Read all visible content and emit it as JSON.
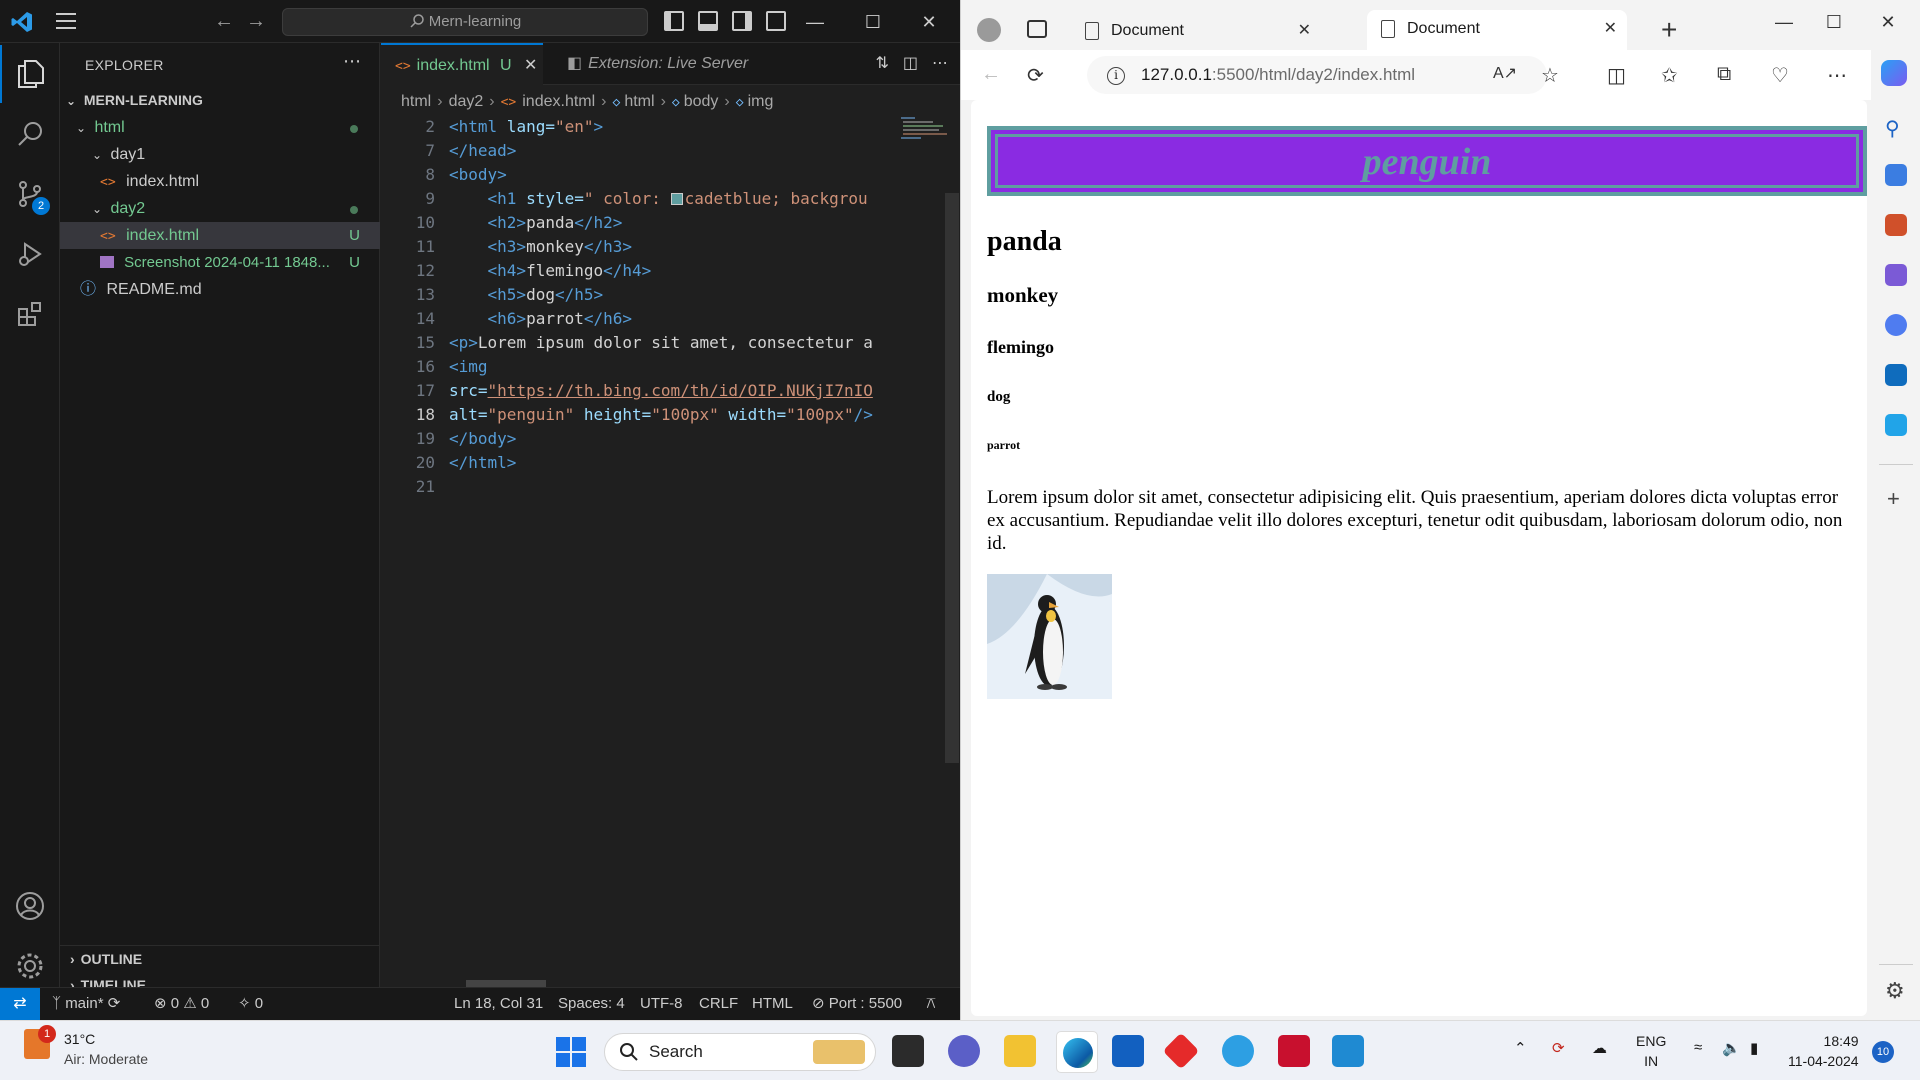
{
  "vscode": {
    "search_text": "Mern-learning",
    "explorer_title": "EXPLORER",
    "tree": {
      "root": "MERN-LEARNING",
      "html_folder": "html",
      "day1": "day1",
      "day1_file": "index.html",
      "day2": "day2",
      "day2_file": "index.html",
      "day2_file_status": "U",
      "screenshot_file": "Screenshot 2024-04-11 1848...",
      "screenshot_status": "U",
      "readme": "README.md"
    },
    "outline_label": "OUTLINE",
    "timeline_label": "TIMELINE",
    "tabs": [
      {
        "label": "index.html",
        "status": "U"
      },
      {
        "label": "Extension: Live Server"
      }
    ],
    "breadcrumb": [
      "html",
      "day2",
      "index.html",
      "html",
      "body",
      "img"
    ],
    "code_lines": [
      {
        "n": "2"
      },
      {
        "n": "7"
      },
      {
        "n": "8"
      },
      {
        "n": "9"
      },
      {
        "n": "10"
      },
      {
        "n": "11"
      },
      {
        "n": "12"
      },
      {
        "n": "13"
      },
      {
        "n": "14"
      },
      {
        "n": "15"
      },
      {
        "n": "16"
      },
      {
        "n": "17"
      },
      {
        "n": "18"
      },
      {
        "n": "19"
      },
      {
        "n": "20"
      },
      {
        "n": "21"
      }
    ],
    "code_text": {
      "l2_tag": "<html",
      "l2_attr": " lang=",
      "l2_val": "\"en\"",
      "l2_end": ">",
      "l7": "</head>",
      "l8": "<body>",
      "l9_tag": "<h1",
      "l9_attr": " style=",
      "l9_val1": "\" color: ",
      "l9_val2": "cadetblue; backgrou",
      "l10": [
        "<h2>",
        "panda",
        "</h2>"
      ],
      "l11": [
        "<h3>",
        "monkey",
        "</h3>"
      ],
      "l12": [
        "<h4>",
        "flemingo",
        "</h4>"
      ],
      "l13": [
        "<h5>",
        "dog",
        "</h5>"
      ],
      "l14": [
        "<h6>",
        "parrot",
        "</h6>"
      ],
      "l15_tag": "<p>",
      "l15_txt": "Lorem ipsum dolor sit amet, consectetur a",
      "l16": "<img",
      "l17_attr": "src=",
      "l17_val": "\"https://th.bing.com/th/id/OIP.NUKjI7nIO",
      "l18_attr1": "alt=",
      "l18_val1": "\"penguin\"",
      "l18_attr2": " height=",
      "l18_val2": "\"100px\"",
      "l18_attr3": " width=",
      "l18_val3": "\"100px\"",
      "l18_end": "/>",
      "l19": "</body>",
      "l20": "</html>"
    },
    "status": {
      "branch": "main*",
      "errors": "0",
      "warnings": "0",
      "ports": "0",
      "position": "Ln 18, Col 31",
      "spaces": "Spaces: 4",
      "encoding": "UTF-8",
      "eol": "CRLF",
      "language": "HTML",
      "port": "Port : 5500"
    },
    "badge_count": "2"
  },
  "edge": {
    "tab1": "Document",
    "tab2": "Document",
    "url_host": "127.0.0.1",
    "url_path": ":5500/html/day2/index.html",
    "page": {
      "h1": "penguin",
      "h2": "panda",
      "h3": "monkey",
      "h4": "flemingo",
      "h5": "dog",
      "h6": "parrot",
      "paragraph": "Lorem ipsum dolor sit amet, consectetur adipisicing elit. Quis praesentium, aperiam dolores dicta voluptas error ex accusantium. Repudiandae velit illo dolores excepturi, tenetur odit quibusdam, laboriosam dolorum odio, non id."
    }
  },
  "taskbar": {
    "weather_temp": "31°C",
    "weather_desc": "Air: Moderate",
    "weather_badge": "1",
    "search_label": "Search",
    "lang": "ENG",
    "region": "IN",
    "time": "18:49",
    "date": "11-04-2024",
    "notifications": "10"
  },
  "colors": {
    "vscode_accent": "#0078d4",
    "h1_background": "#8a2be2",
    "h1_color": "#5f9ea0",
    "git_untracked": "#73c991"
  }
}
